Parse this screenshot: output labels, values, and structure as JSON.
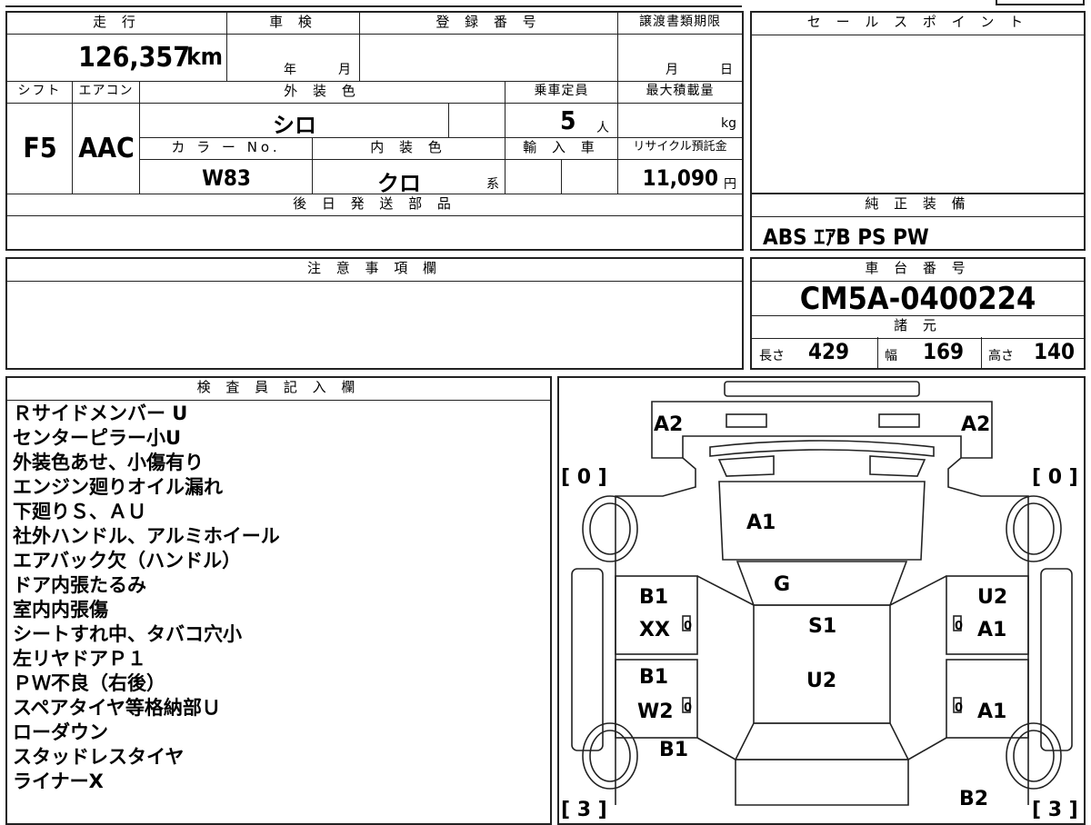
{
  "vehicle": {
    "mileage_header": "走 行",
    "mileage": "126,357",
    "mileage_unit": "km",
    "inspection_header": "車 検",
    "year_label": "年",
    "month_label": "月",
    "registration_header": "登 録 番 号",
    "transfer_header": "譲渡書類期限",
    "transfer_month": "月",
    "transfer_day": "日",
    "shift_header": "シフト",
    "shift": "F5",
    "ac_header": "エアコン",
    "ac": "AAC",
    "exterior_header": "外 装 色",
    "exterior_color": "シロ",
    "capacity_header": "乗車定員",
    "capacity": "5",
    "capacity_unit": "人",
    "max_load_header": "最大積載量",
    "max_load_unit": "kg",
    "color_no_header": "カ ラ ー No.",
    "color_no": "W83",
    "interior_header": "内 装 色",
    "interior_color": "クロ",
    "interior_suffix": "系",
    "import_header": "輸 入 車",
    "recycle_header": "リサイクル預託金",
    "recycle_fee": "11,090",
    "recycle_unit": "円",
    "parts_header": "後 日 発 送 部 品"
  },
  "sale_points": {
    "header": "セ ー ル ス ポ イ ン ト"
  },
  "equipment": {
    "header": "純 正 装 備",
    "items": "ABS ｴｱB PS PW"
  },
  "notes": {
    "header": "注 意 事 項 欄"
  },
  "chassis": {
    "header": "車 台 番 号",
    "number": "CM5A-0400224"
  },
  "specs": {
    "header": "諸 元",
    "length_label": "長さ",
    "length": "429",
    "width_label": "幅",
    "width": "169",
    "height_label": "高さ",
    "height": "140"
  },
  "inspector": {
    "header": "検 査 員 記 入 欄",
    "remarks": [
      "Ｒサイドメンバー U",
      "センターピラー小U",
      "外装色あせ、小傷有り",
      "エンジン廻りオイル漏れ",
      "下廻りＳ、ＡＵ",
      "社外ハンドル、アルミホイール",
      "エアバック欠（ハンドル）",
      "ドア内張たるみ",
      "室内内張傷",
      "シートすれ中、タバコ穴小",
      "左リヤドアＰ１",
      "ＰＷ不良（右後）",
      "スペアタイヤ等格納部Ｕ",
      "ローダウン",
      "スタッドレスタイヤ",
      "ライナーX"
    ]
  },
  "diagram": {
    "tire_fl": "[ 0 ]",
    "tire_fr": "[ 0 ]",
    "tire_rl": "[ 3 ]",
    "tire_rr": "[ 3 ]",
    "front_left": "A2",
    "front_right": "A2",
    "hood": "A1",
    "windshield": "G",
    "roof_upper": "S1",
    "roof_lower": "U2",
    "left_front_door_1": "B1",
    "left_front_door_2": "XX",
    "left_rear_door_1": "B1",
    "left_rear_door_2": "W2",
    "left_rear_quarter": "B1",
    "right_front_door_1": "U2",
    "right_front_door_2": "A1",
    "right_rear_door": "A1",
    "right_rear_quarter": "B2",
    "small_zero": "0"
  }
}
